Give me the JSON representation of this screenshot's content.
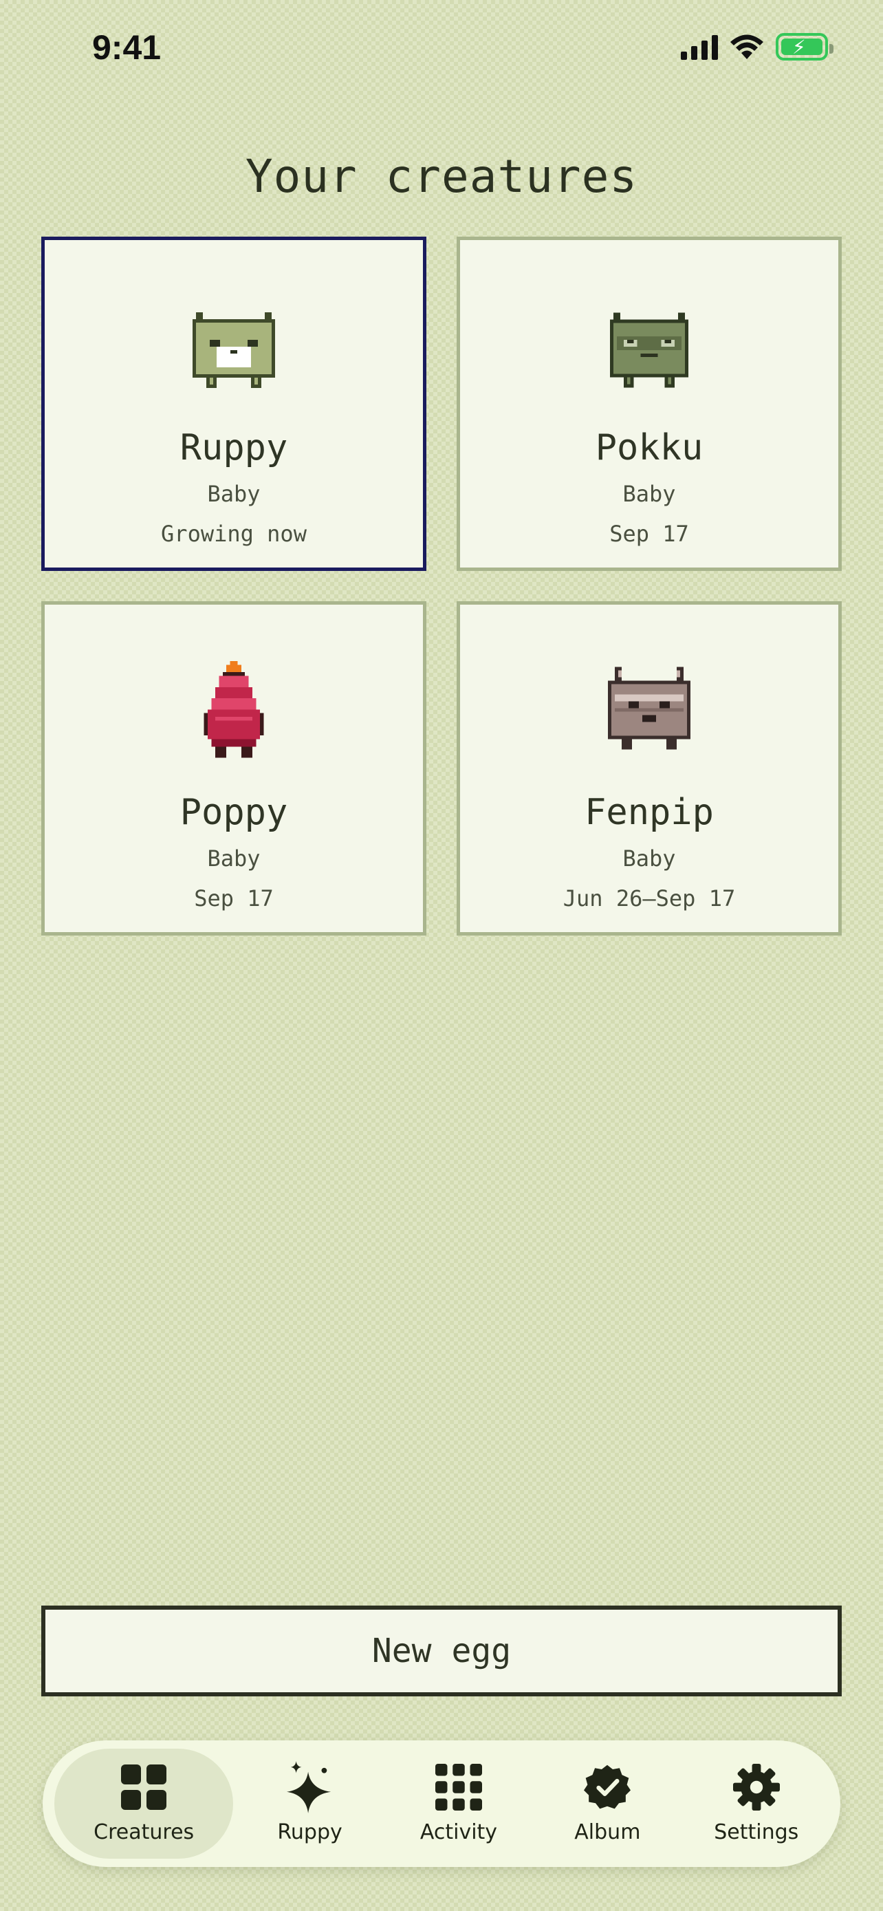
{
  "status_bar": {
    "time": "9:41"
  },
  "title": "Your creatures",
  "creatures": [
    {
      "name": "Ruppy",
      "stage": "Baby",
      "date": "Growing now",
      "selected": true
    },
    {
      "name": "Pokku",
      "stage": "Baby",
      "date": "Sep 17",
      "selected": false
    },
    {
      "name": "Poppy",
      "stage": "Baby",
      "date": "Sep 17",
      "selected": false
    },
    {
      "name": "Fenpip",
      "stage": "Baby",
      "date": "Jun 26–Sep 17",
      "selected": false
    }
  ],
  "new_egg_label": "New egg",
  "tabs": [
    {
      "label": "Creatures",
      "icon": "grid-four-icon",
      "active": true
    },
    {
      "label": "Ruppy",
      "icon": "sparkle-icon",
      "active": false
    },
    {
      "label": "Activity",
      "icon": "grid-nine-icon",
      "active": false
    },
    {
      "label": "Album",
      "icon": "check-badge-icon",
      "active": false
    },
    {
      "label": "Settings",
      "icon": "gear-icon",
      "active": false
    }
  ],
  "colors": {
    "background": "#dfe6c4",
    "card": "#f4f7ea",
    "card_border": "#a9b58d",
    "selected_border": "#1a1b5e",
    "ruppy": "#a8b47c",
    "pokku": "#7a8b5e",
    "poppy": "#c1264a",
    "fenpip": "#9c8680"
  }
}
